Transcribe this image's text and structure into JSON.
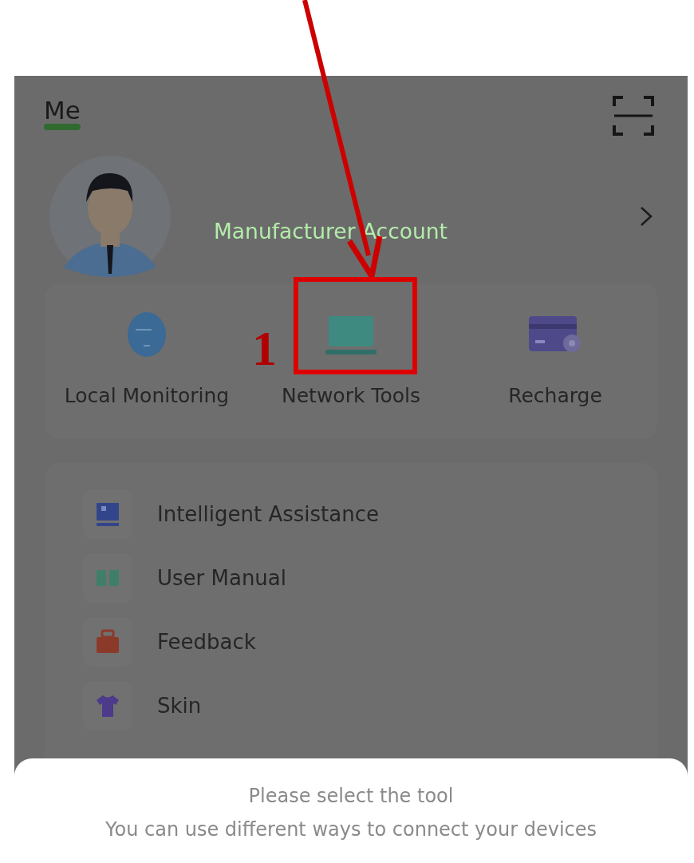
{
  "header": {
    "title": "Me"
  },
  "account": {
    "name": "Manufacturer Account"
  },
  "quick_tools": [
    {
      "label": "Local Monitoring"
    },
    {
      "label": "Network Tools"
    },
    {
      "label": "Recharge"
    }
  ],
  "menu": [
    {
      "label": "Intelligent Assistance"
    },
    {
      "label": "User Manual"
    },
    {
      "label": "Feedback"
    },
    {
      "label": "Skin"
    }
  ],
  "sheet": {
    "title": "Please select the tool",
    "subtitle": "You can use different ways to connect your devices"
  },
  "annotation": {
    "label": "1"
  }
}
